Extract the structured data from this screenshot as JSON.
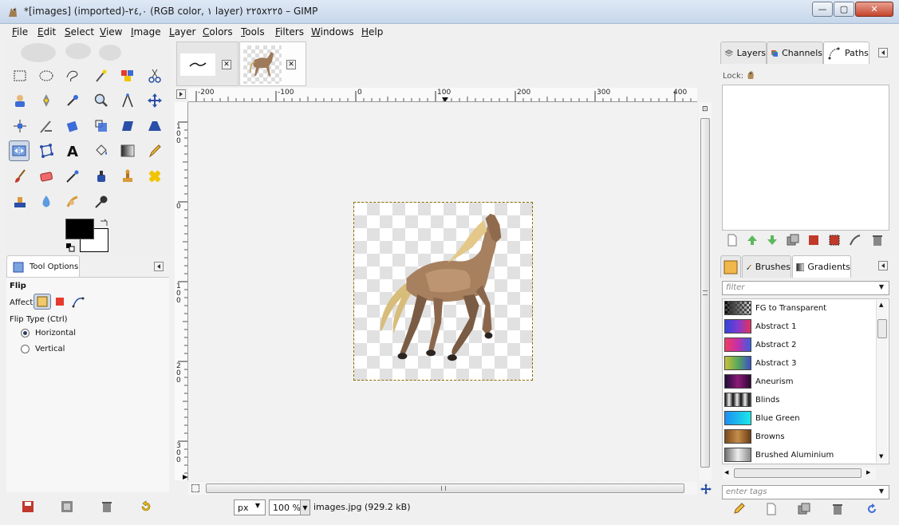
{
  "window": {
    "title": "*[images] (imported)-٢٤,٠ (RGB color, ١ layer) ٢٢٥x٢٢٥ – GIMP",
    "minimize_glyph": "—",
    "maximize_glyph": "▢",
    "close_glyph": "✕"
  },
  "menu": {
    "items": [
      {
        "first": "F",
        "rest": "ile"
      },
      {
        "first": "E",
        "rest": "dit"
      },
      {
        "first": "S",
        "rest": "elect"
      },
      {
        "first": "V",
        "rest": "iew"
      },
      {
        "first": "I",
        "rest": "mage"
      },
      {
        "first": "L",
        "rest": "ayer"
      },
      {
        "first": "C",
        "rest": "olors"
      },
      {
        "first": "T",
        "rest": "ools"
      },
      {
        "first": "F",
        "rest": "ilters"
      },
      {
        "first": "W",
        "rest": "indows"
      },
      {
        "first": "H",
        "rest": "elp"
      }
    ]
  },
  "toolbox": {
    "tools": [
      "rect-select",
      "ellipse-select",
      "free-select",
      "fuzzy-select",
      "select-by-color",
      "scissors",
      "foreground-select",
      "paths",
      "color-picker",
      "zoom",
      "measure",
      "move",
      "align",
      "crop",
      "rotate",
      "scale",
      "shear",
      "perspective",
      "flip",
      "cage",
      "text",
      "bucket-fill",
      "blend",
      "pencil",
      "paintbrush",
      "eraser",
      "airbrush",
      "ink",
      "clone",
      "heal",
      "perspective-clone",
      "blur",
      "smudge",
      "dodge-burn"
    ],
    "active_tool": "flip",
    "fg_color": "#000000",
    "bg_color": "#ffffff"
  },
  "tool_options": {
    "tab_label": "Tool Options",
    "tool_name": "Flip",
    "affect_label": "Affect:",
    "flip_type_label": "Flip Type  (Ctrl)",
    "options": [
      "Horizontal",
      "Vertical"
    ],
    "selected": "Horizontal"
  },
  "image_tabs": [
    {
      "name": "stroke-thumbnail",
      "close": "✕"
    },
    {
      "name": "horse-thumbnail",
      "close": "✕",
      "active": true
    }
  ],
  "rulers": {
    "horizontal": [
      "-200",
      "-100",
      "0",
      "100",
      "200",
      "300",
      "400"
    ],
    "vertical": [
      "100",
      "0",
      "100",
      "200",
      "300"
    ]
  },
  "statusbar": {
    "unit": "px",
    "zoom": "100 %",
    "file_info": "images.jpg (929.2 kB)"
  },
  "dock_top": {
    "tabs": [
      "Layers",
      "Channels",
      "Paths"
    ],
    "active": "Paths",
    "lock_label": "Lock:"
  },
  "dock_bottom": {
    "tabs": [
      "Brushes",
      "Gradients"
    ],
    "active": "Gradients",
    "filter_placeholder": "filter",
    "tags_placeholder": "enter tags",
    "gradients": [
      {
        "name": "FG to Transparent",
        "colors": [
          "#000000",
          "#cfcfcf"
        ]
      },
      {
        "name": "Abstract 1",
        "colors": [
          "#2f44d8",
          "#7f3bd1",
          "#e2325d"
        ]
      },
      {
        "name": "Abstract 2",
        "colors": [
          "#f23c64",
          "#c42fa8",
          "#3a5fe0"
        ]
      },
      {
        "name": "Abstract 3",
        "colors": [
          "#c9c03c",
          "#57a85a",
          "#3d50c4"
        ]
      },
      {
        "name": "Aneurism",
        "colors": [
          "#1d0d37",
          "#8e1a7a",
          "#2b0a30"
        ]
      },
      {
        "name": "Blinds",
        "colors": [
          "#111111",
          "#e5e5e5",
          "#111111"
        ]
      },
      {
        "name": "Blue Green",
        "colors": [
          "#1e8ef2",
          "#19e8e8"
        ]
      },
      {
        "name": "Browns",
        "colors": [
          "#7a4a1c",
          "#c58d4a",
          "#6b3b14"
        ]
      },
      {
        "name": "Brushed Aluminium",
        "colors": [
          "#6e6e6e",
          "#eeeeee",
          "#8a8a8a"
        ]
      }
    ]
  }
}
